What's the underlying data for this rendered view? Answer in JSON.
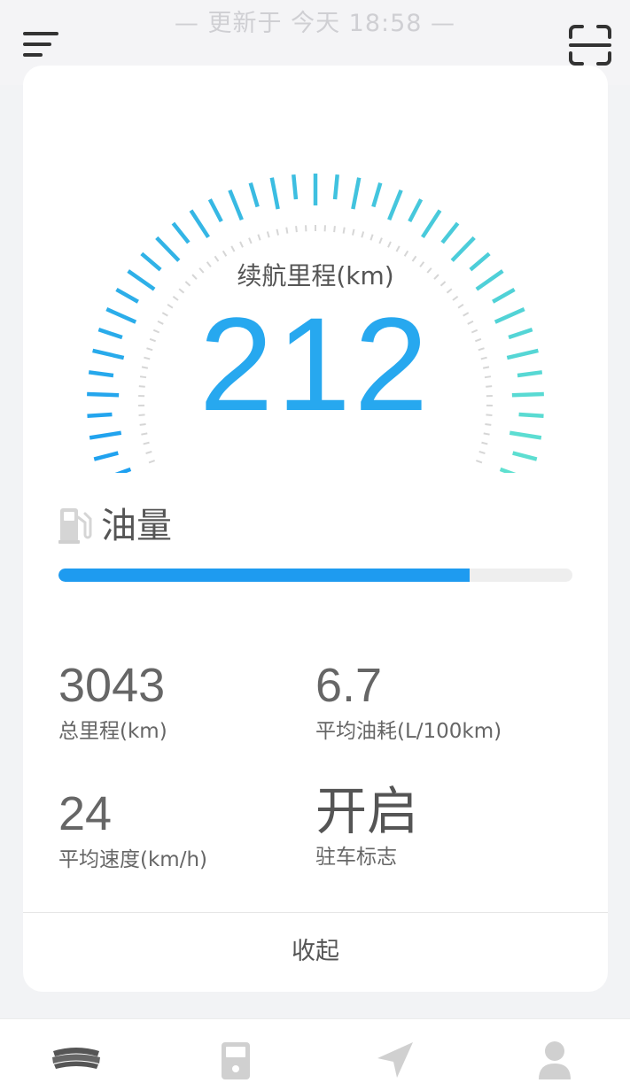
{
  "header": {
    "update_text": "— 更新于 今天 18:58 —",
    "menu_icon": "menu-icon",
    "scan_icon": "scan-icon"
  },
  "gauge": {
    "label": "续航里程(km)",
    "value": "212"
  },
  "fuel": {
    "label": "油量",
    "icon": "fuel-pump-icon",
    "level_fraction": 0.8,
    "fill_color": "#1e9bf0"
  },
  "stats": {
    "total_mileage": {
      "value": "3043",
      "label": "总里程(km)"
    },
    "avg_fuel": {
      "value": "6.7",
      "label": "平均油耗(L/100km)"
    },
    "avg_speed": {
      "value": "24",
      "label": "平均速度(km/h)"
    },
    "parking": {
      "value": "开启",
      "label": "驻车标志"
    }
  },
  "collapse_label": "收起",
  "tabs": [
    {
      "icon": "car-logo-icon",
      "active": true
    },
    {
      "icon": "phone-device-icon",
      "active": false
    },
    {
      "icon": "navigation-arrow-icon",
      "active": false
    },
    {
      "icon": "user-icon",
      "active": false
    }
  ],
  "colors": {
    "accent": "#27a8ef",
    "gauge_start": "#1ea0f0",
    "gauge_end": "#5fe0d0"
  }
}
